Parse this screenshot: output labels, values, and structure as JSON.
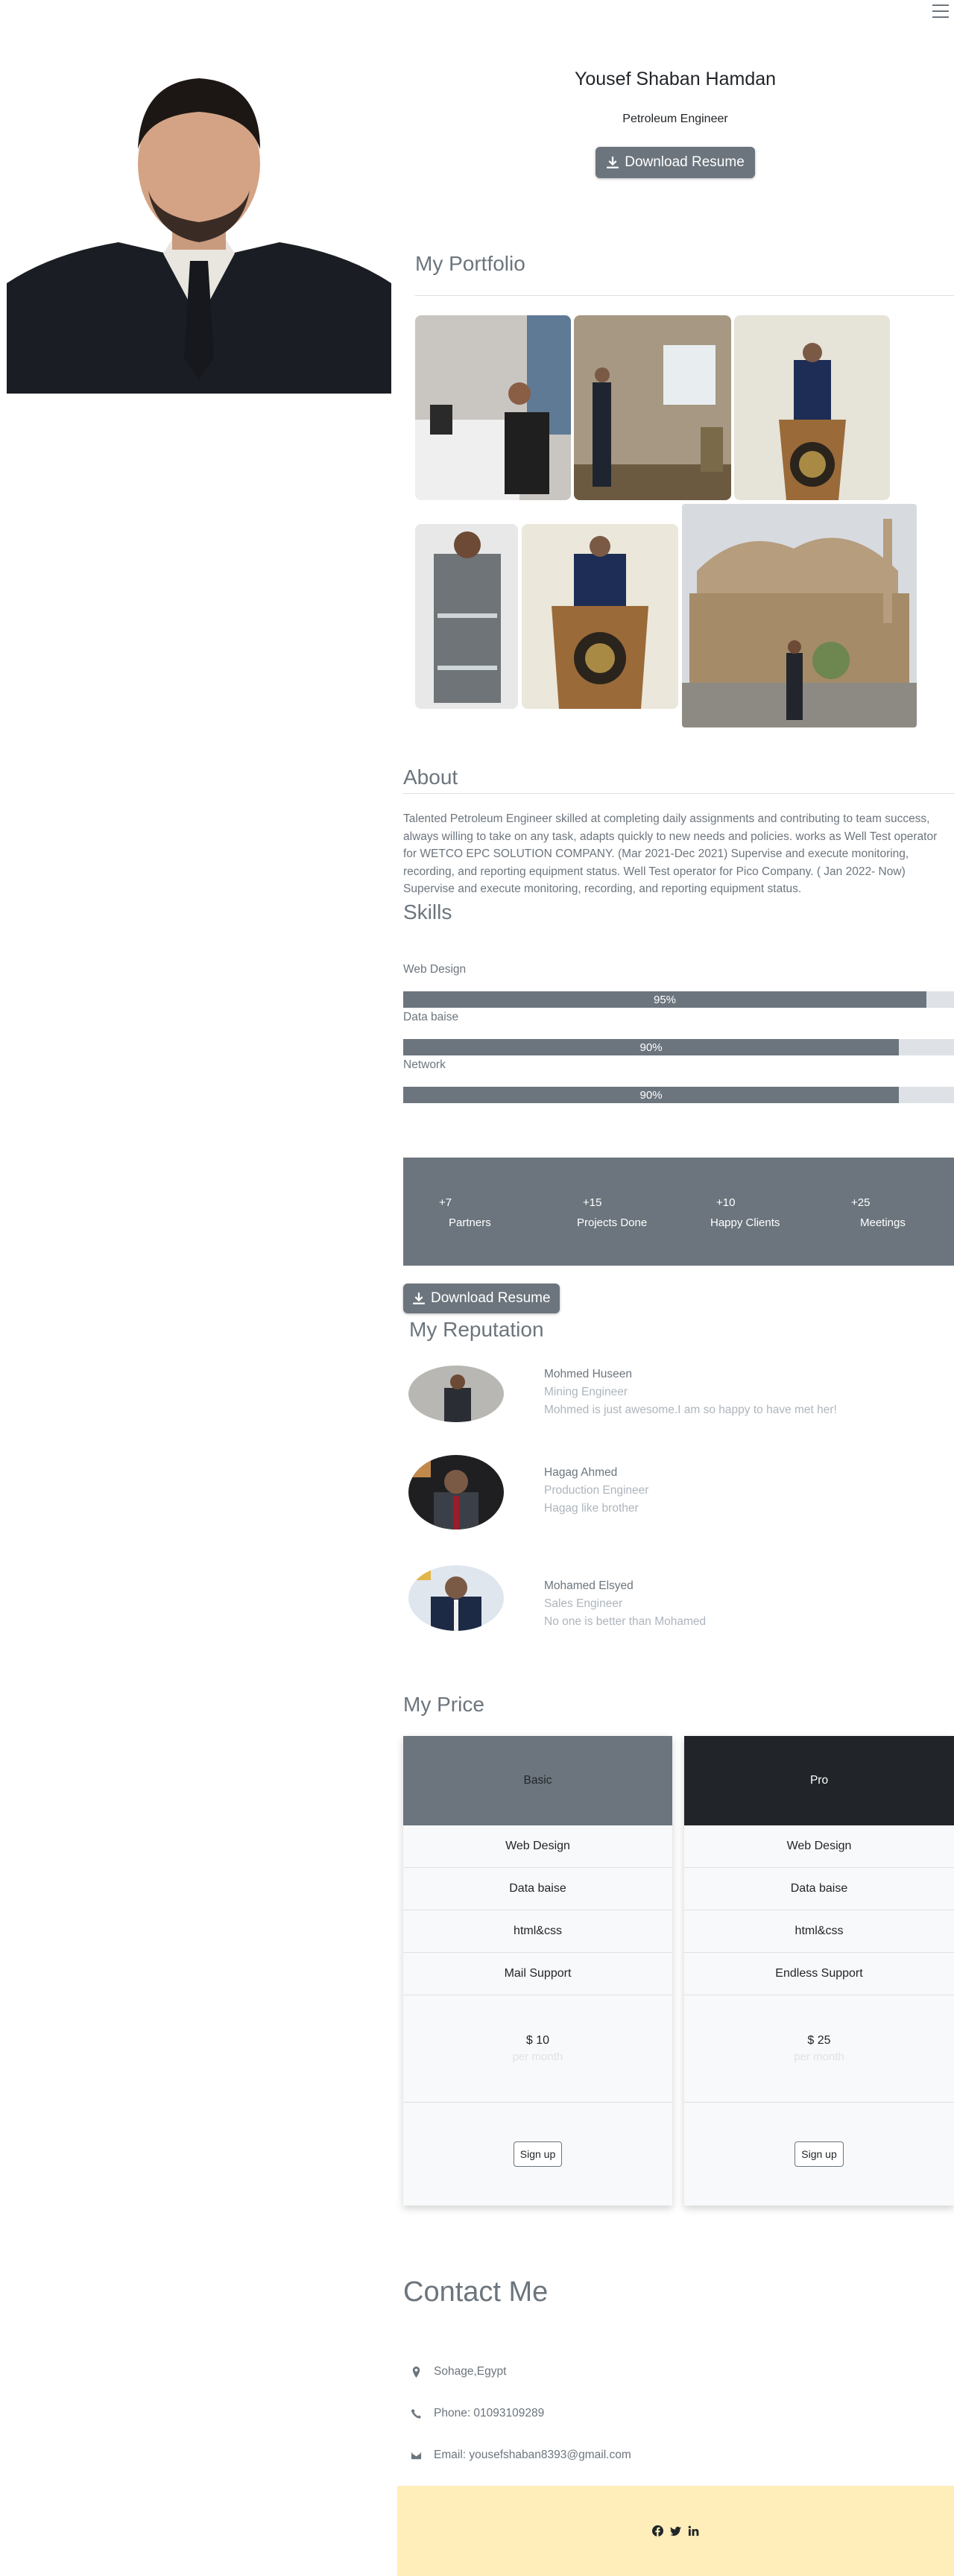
{
  "header": {
    "name": "Yousef Shaban Hamdan",
    "role": "Petroleum Engineer",
    "download_label": "Download Resume"
  },
  "portfolio": {
    "title": "My Portfolio"
  },
  "about": {
    "title": "About",
    "text": "Talented Petroleum Engineer skilled at completing daily assignments and contributing to team success, always willing to take on any task, adapts quickly to new needs and policies. works as Well Test operator for WETCO EPC SOLUTION COMPANY. (Mar 2021-Dec 2021) Supervise and execute monitoring, recording, and reporting equipment status. Well Test operator for Pico Company. ( Jan 2022- Now) Supervise and execute monitoring, recording, and reporting equipment status."
  },
  "skills": {
    "title": "Skills",
    "items": [
      {
        "label": "Web Design",
        "value": 95,
        "text": "95%"
      },
      {
        "label": "Data baise",
        "value": 90,
        "text": "90%"
      },
      {
        "label": "Network",
        "value": 90,
        "text": "90%"
      }
    ]
  },
  "stats": [
    {
      "num": "+7",
      "label": "Partners"
    },
    {
      "num": "+15",
      "label": "Projects Done"
    },
    {
      "num": "+10",
      "label": "Happy Clients"
    },
    {
      "num": "+25",
      "label": "Meetings"
    }
  ],
  "download2_label": "Download Resume",
  "reputation": {
    "title": "My Reputation",
    "items": [
      {
        "name": "Mohmed Huseen",
        "role": "Mining Engineer",
        "quote": "Mohmed is just awesome.I am so happy to have met her!"
      },
      {
        "name": "Hagag Ahmed",
        "role": "Production Engineer",
        "quote": "Hagag like brother"
      },
      {
        "name": "Mohamed Elsyed",
        "role": "Sales Engineer",
        "quote": "No one is better than Mohamed"
      }
    ]
  },
  "pricing": {
    "title": "My Price",
    "plans": [
      {
        "name": "Basic",
        "features": [
          "Web Design",
          "Data baise",
          "html&css",
          "Mail Support"
        ],
        "price": "$ 10",
        "period": "per month",
        "cta": "Sign up",
        "head_color": "#6c757d"
      },
      {
        "name": "Pro",
        "features": [
          "Web Design",
          "Data baise",
          "html&css",
          "Endless Support"
        ],
        "price": "$ 25",
        "period": "per month",
        "cta": "Sign up",
        "head_color": "#212529"
      }
    ]
  },
  "contact": {
    "title": "Contact Me",
    "address": "Sohage,Egypt",
    "phone": "Phone: 01093109289",
    "email": "Email: yousefshaban8393@gmail.com"
  },
  "colors": {
    "accent": "#6c757d",
    "dark": "#212529",
    "footer_bg": "#ffeeba"
  },
  "icons": [
    "menu-icon",
    "download-icon",
    "location-icon",
    "phone-icon",
    "envelope-icon",
    "facebook-icon",
    "twitter-icon",
    "linkedin-icon"
  ]
}
